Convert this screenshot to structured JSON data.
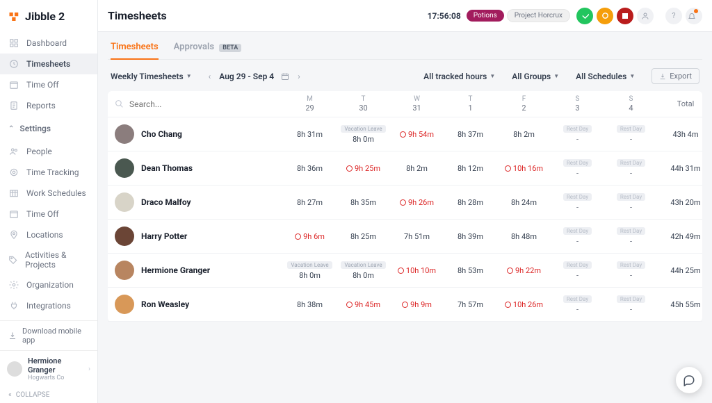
{
  "brand": "Jibble 2",
  "page_title": "Timesheets",
  "clock": "17:56:08",
  "project_pill": "Potions",
  "project_secondary": "Project Horcrux",
  "sidebar": {
    "nav": [
      {
        "label": "Dashboard",
        "icon": "dashboard-icon",
        "active": false
      },
      {
        "label": "Timesheets",
        "icon": "clock-icon",
        "active": true
      },
      {
        "label": "Time Off",
        "icon": "calendar-off-icon",
        "active": false
      },
      {
        "label": "Reports",
        "icon": "report-icon",
        "active": false
      }
    ],
    "settings_label": "Settings",
    "settings": [
      {
        "label": "People",
        "icon": "people-icon"
      },
      {
        "label": "Time Tracking",
        "icon": "tracking-icon"
      },
      {
        "label": "Work Schedules",
        "icon": "schedule-icon"
      },
      {
        "label": "Time Off",
        "icon": "calendar-off-icon"
      },
      {
        "label": "Locations",
        "icon": "pin-icon"
      },
      {
        "label": "Activities & Projects",
        "icon": "tag-icon"
      },
      {
        "label": "Organization",
        "icon": "org-icon"
      },
      {
        "label": "Integrations",
        "icon": "plug-icon"
      }
    ],
    "download_label": "Download mobile app",
    "user_name": "Hermione Granger",
    "user_company": "Hogwarts Co",
    "collapse_label": "COLLAPSE"
  },
  "tabs": {
    "timesheets": "Timesheets",
    "approvals": "Approvals",
    "beta": "BETA"
  },
  "toolbar": {
    "view_mode": "Weekly Timesheets",
    "date_range": "Aug 29 - Sep 4",
    "filter_hours": "All tracked hours",
    "filter_groups": "All Groups",
    "filter_schedules": "All Schedules",
    "export": "Export"
  },
  "search_placeholder": "Search...",
  "days": [
    {
      "d": "M",
      "n": "29"
    },
    {
      "d": "T",
      "n": "30"
    },
    {
      "d": "W",
      "n": "31"
    },
    {
      "d": "T",
      "n": "1"
    },
    {
      "d": "F",
      "n": "2"
    },
    {
      "d": "S",
      "n": "3"
    },
    {
      "d": "S",
      "n": "4"
    }
  ],
  "total_label": "Total",
  "vacation_badge": "Vacation Leave",
  "rest_badge": "Rest Day",
  "rows": [
    {
      "name": "Cho Chang",
      "cells": [
        {
          "t": "8h 31m"
        },
        {
          "t": "8h 0m",
          "badge": "vac"
        },
        {
          "t": "9h 54m",
          "red": true
        },
        {
          "t": "8h 37m"
        },
        {
          "t": "8h 2m"
        },
        {
          "t": "-",
          "badge": "rest"
        },
        {
          "t": "-",
          "badge": "rest"
        }
      ],
      "total": "43h 4m"
    },
    {
      "name": "Dean Thomas",
      "cells": [
        {
          "t": "8h 36m"
        },
        {
          "t": "9h 25m",
          "red": true
        },
        {
          "t": "8h 2m"
        },
        {
          "t": "8h 12m"
        },
        {
          "t": "10h 16m",
          "red": true
        },
        {
          "t": "-",
          "badge": "rest"
        },
        {
          "t": "-",
          "badge": "rest"
        }
      ],
      "total": "44h 31m"
    },
    {
      "name": "Draco Malfoy",
      "cells": [
        {
          "t": "8h 27m"
        },
        {
          "t": "8h 35m"
        },
        {
          "t": "9h 26m",
          "red": true
        },
        {
          "t": "8h 28m"
        },
        {
          "t": "8h 24m"
        },
        {
          "t": "-",
          "badge": "rest"
        },
        {
          "t": "-",
          "badge": "rest"
        }
      ],
      "total": "43h 20m"
    },
    {
      "name": "Harry Potter",
      "cells": [
        {
          "t": "9h 6m",
          "red": true
        },
        {
          "t": "8h 25m"
        },
        {
          "t": "7h 51m"
        },
        {
          "t": "8h 39m"
        },
        {
          "t": "8h 48m"
        },
        {
          "t": "-",
          "badge": "rest"
        },
        {
          "t": "-",
          "badge": "rest"
        }
      ],
      "total": "42h 49m"
    },
    {
      "name": "Hermione Granger",
      "cells": [
        {
          "t": "8h 0m",
          "badge": "vac"
        },
        {
          "t": "8h 0m",
          "badge": "vac"
        },
        {
          "t": "10h 10m",
          "red": true
        },
        {
          "t": "8h 53m"
        },
        {
          "t": "9h 22m",
          "red": true
        },
        {
          "t": "-",
          "badge": "rest"
        },
        {
          "t": "-",
          "badge": "rest"
        }
      ],
      "total": "44h 25m"
    },
    {
      "name": "Ron Weasley",
      "cells": [
        {
          "t": "8h 38m"
        },
        {
          "t": "9h 45m",
          "red": true
        },
        {
          "t": "9h 9m",
          "red": true
        },
        {
          "t": "7h 57m"
        },
        {
          "t": "10h 26m",
          "red": true
        },
        {
          "t": "-",
          "badge": "rest"
        },
        {
          "t": "-",
          "badge": "rest"
        }
      ],
      "total": "45h 55m"
    }
  ]
}
